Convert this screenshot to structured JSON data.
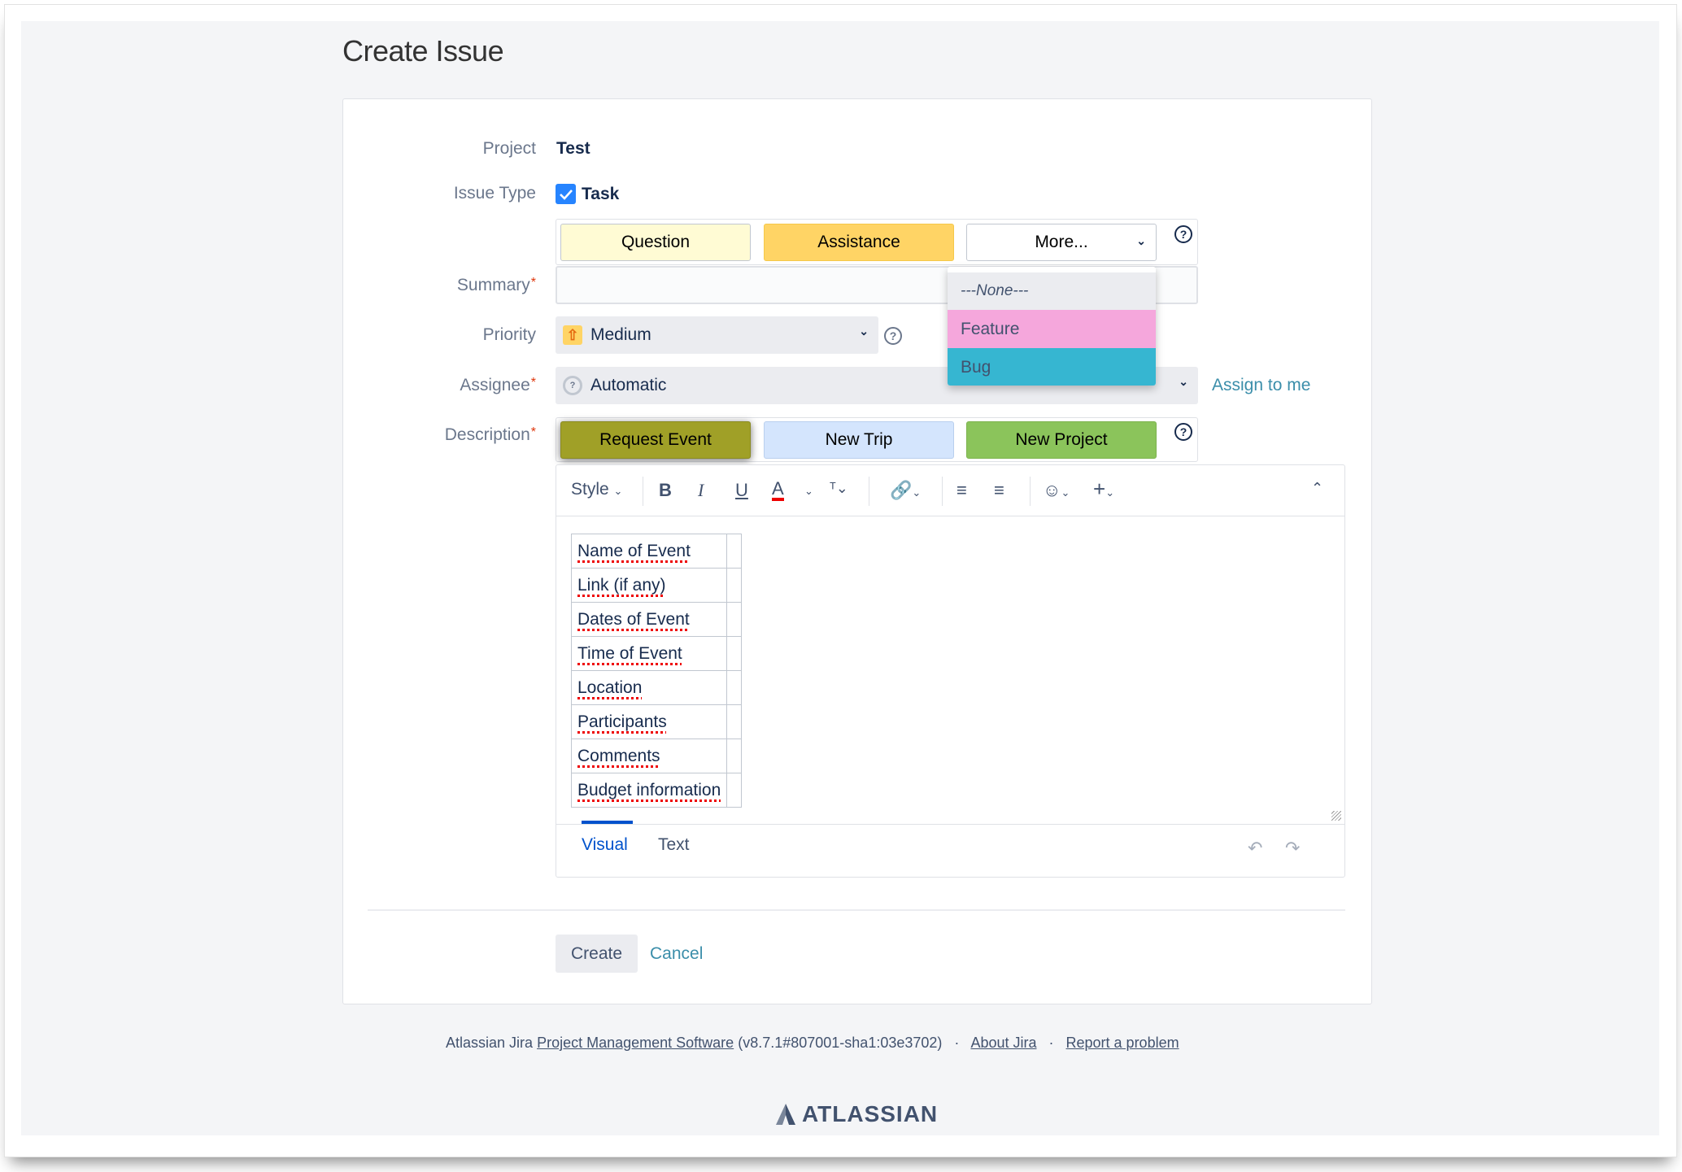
{
  "page": {
    "title": "Create Issue"
  },
  "form": {
    "project": {
      "label": "Project",
      "value": "Test"
    },
    "issue_type": {
      "label": "Issue Type",
      "value": "Task",
      "checked": true,
      "template_buttons": [
        {
          "label": "Question",
          "color": "#fffbd4"
        },
        {
          "label": "Assistance",
          "color": "#ffd465"
        },
        {
          "label": "More...",
          "color": "#ffffff"
        }
      ],
      "more_dropdown": {
        "open": true,
        "options": [
          {
            "label": "---None---",
            "color": "#ebecf0"
          },
          {
            "label": "Feature",
            "color": "#f5a7dc"
          },
          {
            "label": "Bug",
            "color": "#36b6d1"
          }
        ]
      }
    },
    "summary": {
      "label": "Summary",
      "required": "*",
      "value": "",
      "placeholder": ""
    },
    "priority": {
      "label": "Priority",
      "value": "Medium",
      "icon": "arrow-up-icon"
    },
    "assignee": {
      "label": "Assignee",
      "required": "*",
      "value": "Automatic",
      "assign_to_me": "Assign to me"
    },
    "description": {
      "label": "Description",
      "required": "*",
      "template_buttons": [
        {
          "label": "Request Event",
          "color": "#a0a027",
          "selected": true
        },
        {
          "label": "New Trip",
          "color": "#d4e5fd"
        },
        {
          "label": "New Project",
          "color": "#8bc45b"
        }
      ],
      "toolbar": {
        "style_label": "Style",
        "bold": "B",
        "italic": "I",
        "underline": "U",
        "text_color": "A"
      },
      "table_rows": [
        "Name of Event",
        "Link (if any)",
        "Dates of Event",
        "Time of Event",
        "Location",
        "Participants",
        "Comments",
        "Budget information"
      ],
      "modes": [
        {
          "label": "Visual",
          "active": true
        },
        {
          "label": "Text",
          "active": false
        }
      ]
    },
    "actions": {
      "create": "Create",
      "cancel": "Cancel"
    }
  },
  "footer": {
    "prefix": "Atlassian Jira",
    "product_link": "Project Management Software",
    "version": "(v8.7.1#807001-sha1:03e3702)",
    "about": "About Jira",
    "report": "Report a problem",
    "separator": "·",
    "logo": "ATLASSIAN"
  },
  "colors": {
    "link": "#3b8eaa",
    "accent": "#0052cc",
    "required": "#de350b"
  }
}
